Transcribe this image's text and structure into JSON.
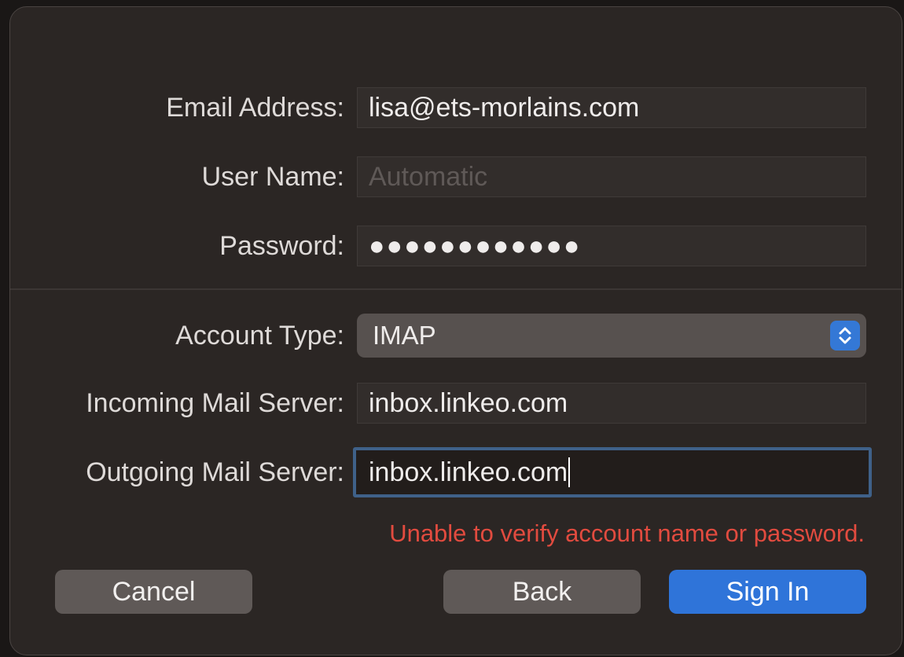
{
  "form": {
    "email": {
      "label": "Email Address:",
      "value": "lisa@ets-morlains.com"
    },
    "username": {
      "label": "User Name:",
      "placeholder": "Automatic",
      "value": ""
    },
    "password": {
      "label": "Password:",
      "value": "●●●●●●●●●●●●"
    },
    "account_type": {
      "label": "Account Type:",
      "value": "IMAP"
    },
    "incoming": {
      "label": "Incoming Mail Server:",
      "value": "inbox.linkeo.com"
    },
    "outgoing": {
      "label": "Outgoing Mail Server:",
      "value": "inbox.linkeo.com"
    }
  },
  "error_message": "Unable to verify account name or password.",
  "buttons": {
    "cancel": "Cancel",
    "back": "Back",
    "sign_in": "Sign In"
  },
  "icons": {
    "select_arrows": "up-down-chevron-icon"
  },
  "colors": {
    "background": "#2b2624",
    "accent": "#2f74d9",
    "error": "#e24b3f",
    "focus_ring": "#3f6189"
  }
}
